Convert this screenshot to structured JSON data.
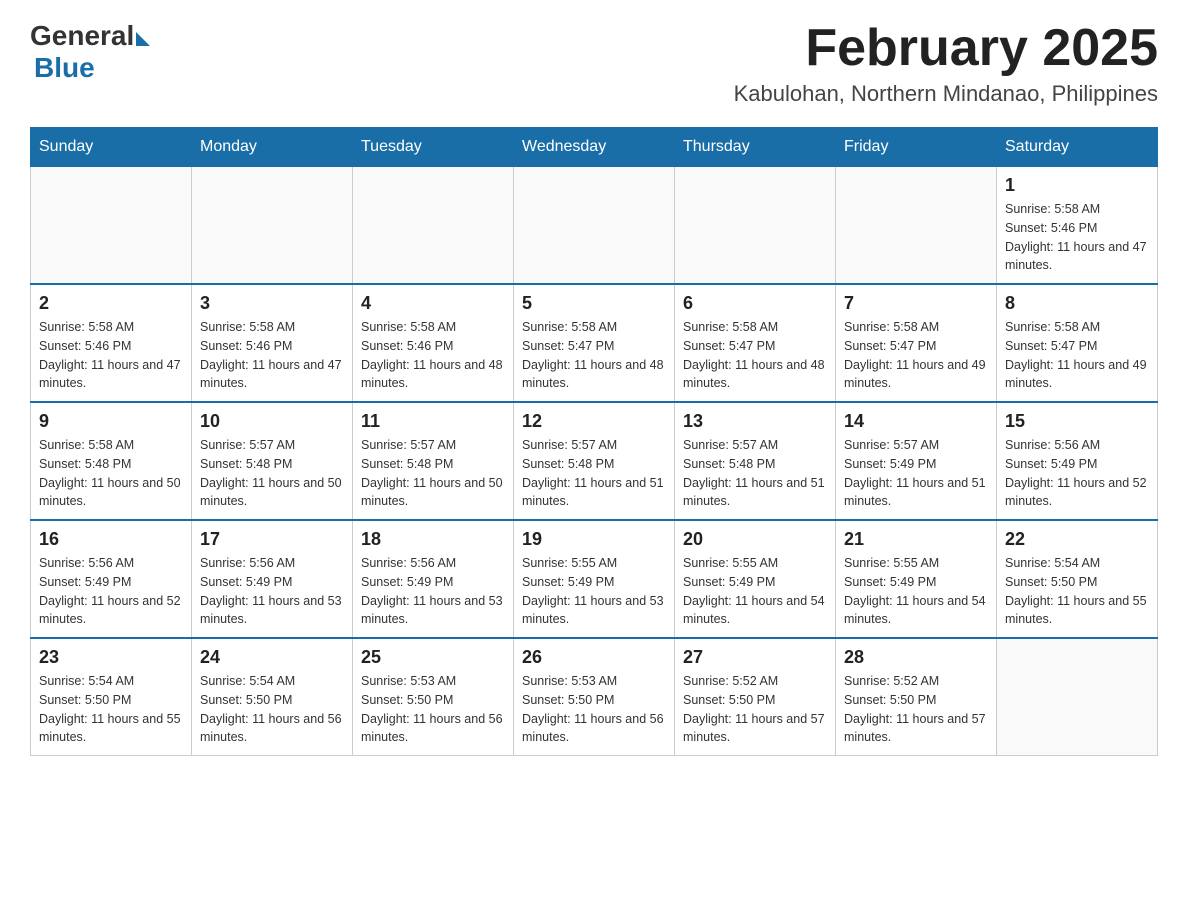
{
  "header": {
    "logo_general": "General",
    "logo_blue": "Blue",
    "month_title": "February 2025",
    "location": "Kabulohan, Northern Mindanao, Philippines"
  },
  "days_of_week": [
    "Sunday",
    "Monday",
    "Tuesday",
    "Wednesday",
    "Thursday",
    "Friday",
    "Saturday"
  ],
  "weeks": [
    [
      {
        "day": "",
        "info": ""
      },
      {
        "day": "",
        "info": ""
      },
      {
        "day": "",
        "info": ""
      },
      {
        "day": "",
        "info": ""
      },
      {
        "day": "",
        "info": ""
      },
      {
        "day": "",
        "info": ""
      },
      {
        "day": "1",
        "info": "Sunrise: 5:58 AM\nSunset: 5:46 PM\nDaylight: 11 hours and 47 minutes."
      }
    ],
    [
      {
        "day": "2",
        "info": "Sunrise: 5:58 AM\nSunset: 5:46 PM\nDaylight: 11 hours and 47 minutes."
      },
      {
        "day": "3",
        "info": "Sunrise: 5:58 AM\nSunset: 5:46 PM\nDaylight: 11 hours and 47 minutes."
      },
      {
        "day": "4",
        "info": "Sunrise: 5:58 AM\nSunset: 5:46 PM\nDaylight: 11 hours and 48 minutes."
      },
      {
        "day": "5",
        "info": "Sunrise: 5:58 AM\nSunset: 5:47 PM\nDaylight: 11 hours and 48 minutes."
      },
      {
        "day": "6",
        "info": "Sunrise: 5:58 AM\nSunset: 5:47 PM\nDaylight: 11 hours and 48 minutes."
      },
      {
        "day": "7",
        "info": "Sunrise: 5:58 AM\nSunset: 5:47 PM\nDaylight: 11 hours and 49 minutes."
      },
      {
        "day": "8",
        "info": "Sunrise: 5:58 AM\nSunset: 5:47 PM\nDaylight: 11 hours and 49 minutes."
      }
    ],
    [
      {
        "day": "9",
        "info": "Sunrise: 5:58 AM\nSunset: 5:48 PM\nDaylight: 11 hours and 50 minutes."
      },
      {
        "day": "10",
        "info": "Sunrise: 5:57 AM\nSunset: 5:48 PM\nDaylight: 11 hours and 50 minutes."
      },
      {
        "day": "11",
        "info": "Sunrise: 5:57 AM\nSunset: 5:48 PM\nDaylight: 11 hours and 50 minutes."
      },
      {
        "day": "12",
        "info": "Sunrise: 5:57 AM\nSunset: 5:48 PM\nDaylight: 11 hours and 51 minutes."
      },
      {
        "day": "13",
        "info": "Sunrise: 5:57 AM\nSunset: 5:48 PM\nDaylight: 11 hours and 51 minutes."
      },
      {
        "day": "14",
        "info": "Sunrise: 5:57 AM\nSunset: 5:49 PM\nDaylight: 11 hours and 51 minutes."
      },
      {
        "day": "15",
        "info": "Sunrise: 5:56 AM\nSunset: 5:49 PM\nDaylight: 11 hours and 52 minutes."
      }
    ],
    [
      {
        "day": "16",
        "info": "Sunrise: 5:56 AM\nSunset: 5:49 PM\nDaylight: 11 hours and 52 minutes."
      },
      {
        "day": "17",
        "info": "Sunrise: 5:56 AM\nSunset: 5:49 PM\nDaylight: 11 hours and 53 minutes."
      },
      {
        "day": "18",
        "info": "Sunrise: 5:56 AM\nSunset: 5:49 PM\nDaylight: 11 hours and 53 minutes."
      },
      {
        "day": "19",
        "info": "Sunrise: 5:55 AM\nSunset: 5:49 PM\nDaylight: 11 hours and 53 minutes."
      },
      {
        "day": "20",
        "info": "Sunrise: 5:55 AM\nSunset: 5:49 PM\nDaylight: 11 hours and 54 minutes."
      },
      {
        "day": "21",
        "info": "Sunrise: 5:55 AM\nSunset: 5:49 PM\nDaylight: 11 hours and 54 minutes."
      },
      {
        "day": "22",
        "info": "Sunrise: 5:54 AM\nSunset: 5:50 PM\nDaylight: 11 hours and 55 minutes."
      }
    ],
    [
      {
        "day": "23",
        "info": "Sunrise: 5:54 AM\nSunset: 5:50 PM\nDaylight: 11 hours and 55 minutes."
      },
      {
        "day": "24",
        "info": "Sunrise: 5:54 AM\nSunset: 5:50 PM\nDaylight: 11 hours and 56 minutes."
      },
      {
        "day": "25",
        "info": "Sunrise: 5:53 AM\nSunset: 5:50 PM\nDaylight: 11 hours and 56 minutes."
      },
      {
        "day": "26",
        "info": "Sunrise: 5:53 AM\nSunset: 5:50 PM\nDaylight: 11 hours and 56 minutes."
      },
      {
        "day": "27",
        "info": "Sunrise: 5:52 AM\nSunset: 5:50 PM\nDaylight: 11 hours and 57 minutes."
      },
      {
        "day": "28",
        "info": "Sunrise: 5:52 AM\nSunset: 5:50 PM\nDaylight: 11 hours and 57 minutes."
      },
      {
        "day": "",
        "info": ""
      }
    ]
  ]
}
